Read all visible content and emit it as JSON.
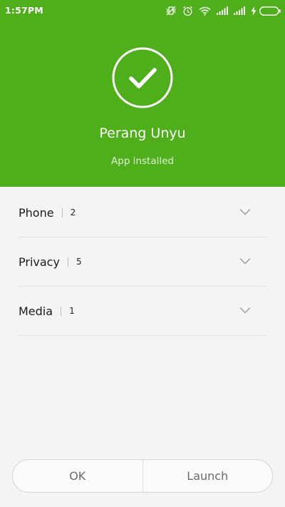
{
  "status_bar": {
    "time": "1:57PM",
    "icons": [
      "vibrate-off-icon",
      "alarm-icon",
      "wifi-icon",
      "signal-icon",
      "signal-icon",
      "charging-icon",
      "battery-icon"
    ]
  },
  "header": {
    "icon": "check-circle-icon",
    "app_name": "Perang Unyu",
    "status": "App installed"
  },
  "permissions": [
    {
      "label": "Phone",
      "count": "2"
    },
    {
      "label": "Privacy",
      "count": "5"
    },
    {
      "label": "Media",
      "count": "1"
    }
  ],
  "footer": {
    "ok_label": "OK",
    "launch_label": "Launch"
  },
  "colors": {
    "header_bg": "#4faf1a",
    "page_bg": "#f4f4f4"
  }
}
